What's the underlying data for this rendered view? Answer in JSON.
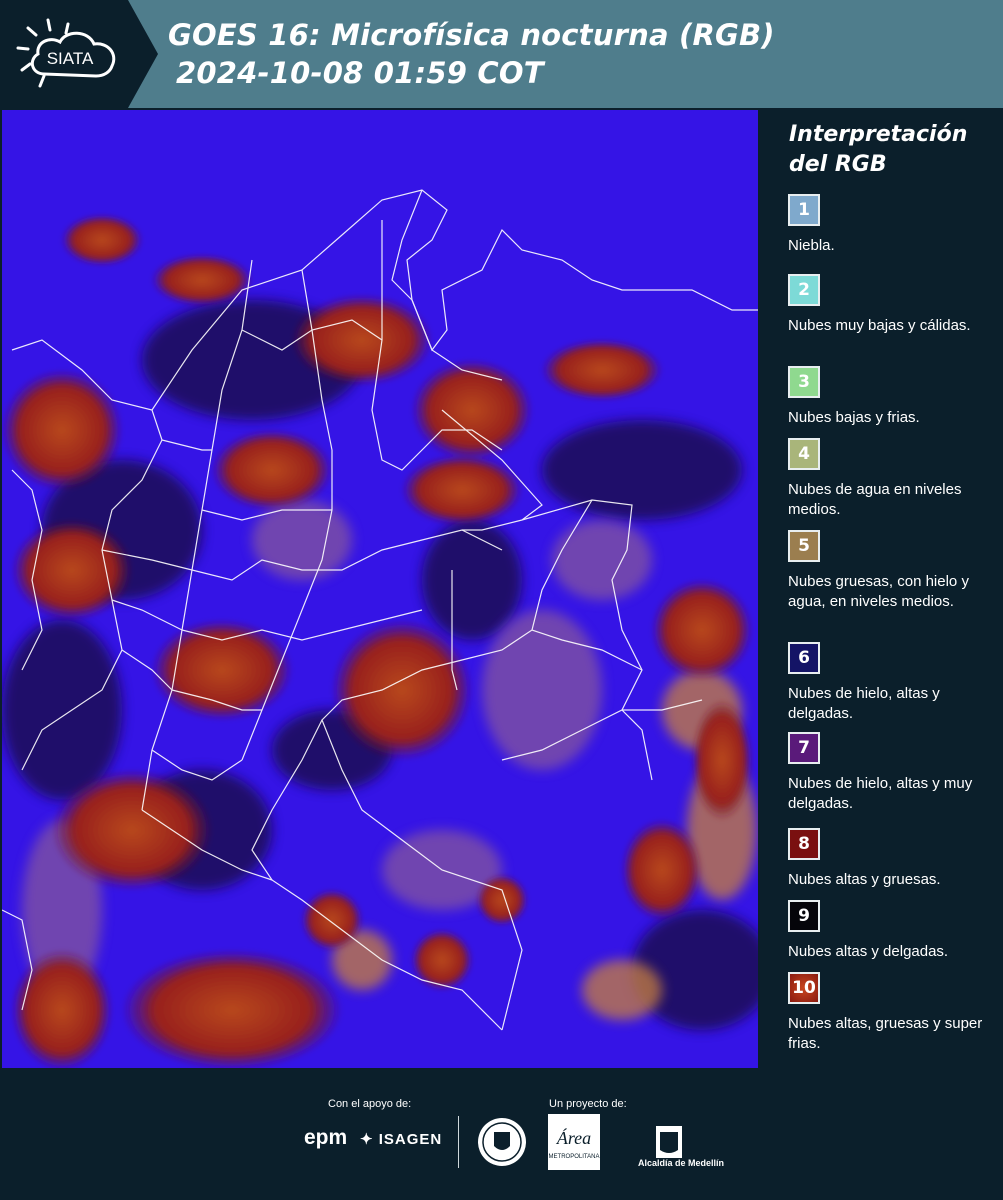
{
  "header": {
    "logo_text": "SIATA",
    "title_line1": "GOES 16: Microfísica nocturna (RGB)",
    "title_line2": "2024-10-08 01:59 COT"
  },
  "legend": {
    "title_line1": "Interpretación",
    "title_line2": "del RGB",
    "items": [
      {
        "num": "1",
        "label": "Niebla.",
        "color": "#7fa9cc"
      },
      {
        "num": "2",
        "label": "Nubes muy bajas y cálidas.",
        "color": "#7ddad7"
      },
      {
        "num": "3",
        "label": "Nubes bajas y frias.",
        "color": "#8fd98f"
      },
      {
        "num": "4",
        "label": "Nubes de agua en niveles medios.",
        "color": "#a9b57a"
      },
      {
        "num": "5",
        "label": "Nubes gruesas, con hielo y agua, en niveles medios.",
        "color": "#9b7e4f"
      },
      {
        "num": "6",
        "label": "Nubes de hielo, altas y delgadas.",
        "color": "#141466"
      },
      {
        "num": "7",
        "label": "Nubes de hielo, altas y muy delgadas.",
        "color": "#5a1a7a"
      },
      {
        "num": "8",
        "label": "Nubes altas y gruesas.",
        "color": "#7a1010"
      },
      {
        "num": "9",
        "label": "Nubes altas y delgadas.",
        "color": "#05050a"
      },
      {
        "num": "10",
        "label": "Nubes altas, gruesas y super frias.",
        "color": "#a32a12"
      }
    ]
  },
  "footer": {
    "support_label": "Con el apoyo de:",
    "project_label": "Un proyecto de:",
    "epm": "epm",
    "isagen": "ISAGEN",
    "amva": "Área",
    "amva_sub": "METROPOLITANA",
    "alcaldia": "Alcaldía de Medellín"
  },
  "colors": {
    "header_bg": "#4f7d8c",
    "panel_bg": "#0b1f2b",
    "map_base": "#3a12e0",
    "cloud_red": "#a3281a",
    "border_white": "#ffffff"
  }
}
